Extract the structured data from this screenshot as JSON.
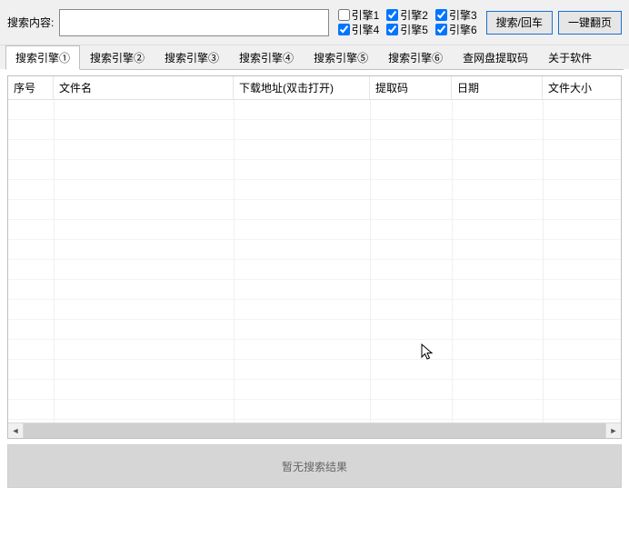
{
  "search": {
    "label": "搜索内容: ",
    "value": "",
    "placeholder": ""
  },
  "engines": [
    {
      "label": "引擎1",
      "checked": false
    },
    {
      "label": "引擎2",
      "checked": true
    },
    {
      "label": "引擎3",
      "checked": true
    },
    {
      "label": "引擎4",
      "checked": true
    },
    {
      "label": "引擎5",
      "checked": true
    },
    {
      "label": "引擎6",
      "checked": true
    }
  ],
  "buttons": {
    "search": "搜索/回车",
    "page_all": "一键翻页"
  },
  "tabs": [
    "搜索引擎①",
    "搜索引擎②",
    "搜索引擎③",
    "搜索引擎④",
    "搜索引擎⑤",
    "搜索引擎⑥",
    "查网盘提取码",
    "关于软件"
  ],
  "active_tab": 0,
  "columns": [
    "序号",
    "文件名",
    "下载地址(双击打开)",
    "提取码",
    "日期",
    "文件大小"
  ],
  "rows": [],
  "status": "暂无搜索结果"
}
